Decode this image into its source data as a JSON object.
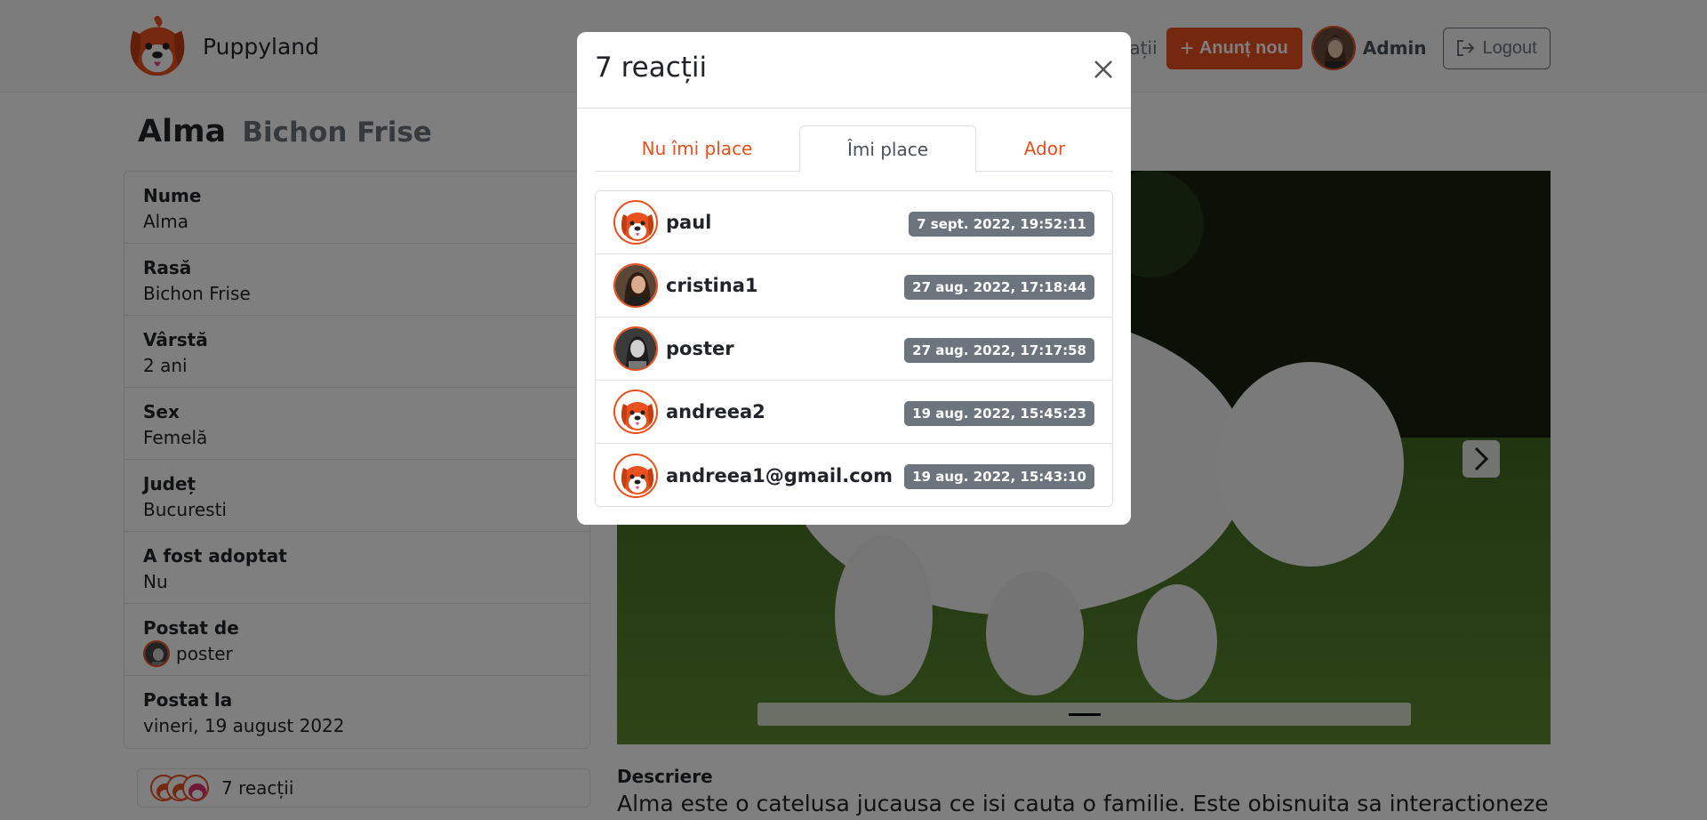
{
  "brand": {
    "name": "Puppyland"
  },
  "nav": {
    "partial_link": "sații",
    "new_button": "Anunț nou",
    "new_plus": "+",
    "user": "Admin",
    "logout": "Logout"
  },
  "page": {
    "name": "Alma",
    "breed": "Bichon Frise"
  },
  "info": [
    {
      "label": "Nume",
      "value": "Alma"
    },
    {
      "label": "Rasă",
      "value": "Bichon Frise"
    },
    {
      "label": "Vârstă",
      "value": "2 ani"
    },
    {
      "label": "Sex",
      "value": "Femelă"
    },
    {
      "label": "Județ",
      "value": "Bucuresti"
    },
    {
      "label": "A fost adoptat",
      "value": "Nu"
    },
    {
      "label": "Postat de",
      "value": "poster"
    },
    {
      "label": "Postat la",
      "value": "vineri, 19 august 2022"
    }
  ],
  "reactions_bar": {
    "count_text": "7 reacții"
  },
  "description": {
    "label": "Descriere",
    "text": "Alma este o catelusa jucausa ce isi cauta o familie. Este obisnuita sa interactioneze"
  },
  "modal": {
    "title": "7 reacții",
    "tabs": [
      {
        "label": "Nu îmi place",
        "active": false
      },
      {
        "label": "Îmi place",
        "active": true
      },
      {
        "label": "Ador",
        "active": false
      }
    ],
    "users": [
      {
        "name": "paul",
        "date": "7 sept. 2022, 19:52:11",
        "avatar": "logo"
      },
      {
        "name": "cristina1",
        "date": "27 aug. 2022, 17:18:44",
        "avatar": "photo-woman"
      },
      {
        "name": "poster",
        "date": "27 aug. 2022, 17:17:58",
        "avatar": "photo-bw"
      },
      {
        "name": "andreea2",
        "date": "19 aug. 2022, 15:45:23",
        "avatar": "logo"
      },
      {
        "name": "andreea1@gmail.com",
        "date": "19 aug. 2022, 15:43:10",
        "avatar": "logo"
      }
    ]
  },
  "colors": {
    "accent": "#e8501e",
    "badge": "#6c757d",
    "backdrop": "rgba(0,0,0,0.5)"
  }
}
